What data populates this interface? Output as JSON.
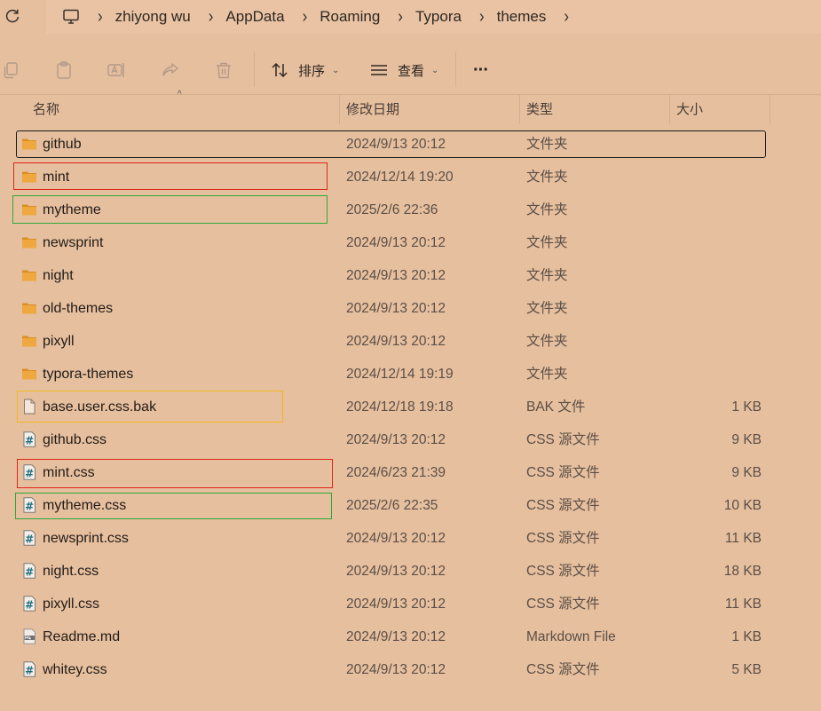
{
  "address_bar": {
    "crumbs": [
      "zhiyong wu",
      "AppData",
      "Roaming",
      "Typora",
      "themes"
    ]
  },
  "toolbar": {
    "sort_label": "排序",
    "view_label": "查看",
    "more_label": "···"
  },
  "columns": {
    "name": "名称",
    "date": "修改日期",
    "type": "类型",
    "size": "大小"
  },
  "files": [
    {
      "name": "github",
      "date": "2024/9/13 20:12",
      "type": "文件夹",
      "size": "",
      "icon": "folder-icon"
    },
    {
      "name": "mint",
      "date": "2024/12/14 19:20",
      "type": "文件夹",
      "size": "",
      "icon": "folder-icon"
    },
    {
      "name": "mytheme",
      "date": "2025/2/6 22:36",
      "type": "文件夹",
      "size": "",
      "icon": "folder-icon"
    },
    {
      "name": "newsprint",
      "date": "2024/9/13 20:12",
      "type": "文件夹",
      "size": "",
      "icon": "folder-icon"
    },
    {
      "name": "night",
      "date": "2024/9/13 20:12",
      "type": "文件夹",
      "size": "",
      "icon": "folder-icon"
    },
    {
      "name": "old-themes",
      "date": "2024/9/13 20:12",
      "type": "文件夹",
      "size": "",
      "icon": "folder-icon"
    },
    {
      "name": "pixyll",
      "date": "2024/9/13 20:12",
      "type": "文件夹",
      "size": "",
      "icon": "folder-icon"
    },
    {
      "name": "typora-themes",
      "date": "2024/12/14 19:19",
      "type": "文件夹",
      "size": "",
      "icon": "folder-icon"
    },
    {
      "name": "base.user.css.bak",
      "date": "2024/12/18 19:18",
      "type": "BAK 文件",
      "size": "1 KB",
      "icon": "blank-file-icon"
    },
    {
      "name": "github.css",
      "date": "2024/9/13 20:12",
      "type": "CSS 源文件",
      "size": "9 KB",
      "icon": "css-file-icon"
    },
    {
      "name": "mint.css",
      "date": "2024/6/23 21:39",
      "type": "CSS 源文件",
      "size": "9 KB",
      "icon": "css-file-icon"
    },
    {
      "name": "mytheme.css",
      "date": "2025/2/6 22:35",
      "type": "CSS 源文件",
      "size": "10 KB",
      "icon": "css-file-icon"
    },
    {
      "name": "newsprint.css",
      "date": "2024/9/13 20:12",
      "type": "CSS 源文件",
      "size": "11 KB",
      "icon": "css-file-icon"
    },
    {
      "name": "night.css",
      "date": "2024/9/13 20:12",
      "type": "CSS 源文件",
      "size": "18 KB",
      "icon": "css-file-icon"
    },
    {
      "name": "pixyll.css",
      "date": "2024/9/13 20:12",
      "type": "CSS 源文件",
      "size": "11 KB",
      "icon": "css-file-icon"
    },
    {
      "name": "Readme.md",
      "date": "2024/9/13 20:12",
      "type": "Markdown File",
      "size": "1 KB",
      "icon": "markdown-file-icon"
    },
    {
      "name": "whitey.css",
      "date": "2024/9/13 20:12",
      "type": "CSS 源文件",
      "size": "5 KB",
      "icon": "css-file-icon"
    }
  ],
  "highlight_colors": {
    "selected": "#1a1a1a",
    "red": "#e0251b",
    "green": "#2ea83a",
    "yellow": "#f0b81e"
  },
  "theme": {
    "background": "#e6bf9e",
    "folder": "#e8a33d"
  }
}
